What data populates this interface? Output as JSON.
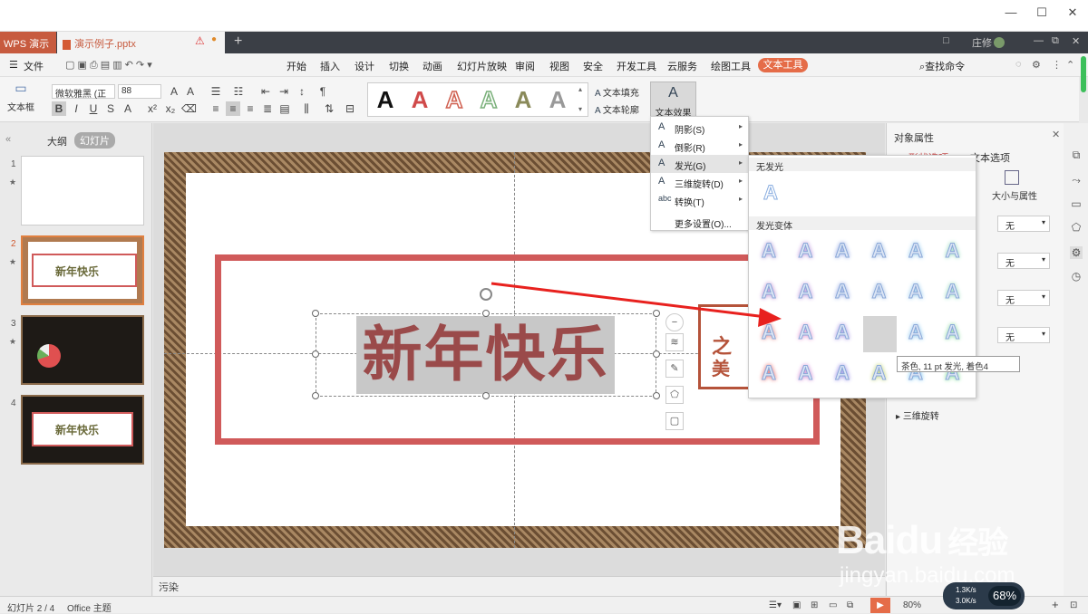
{
  "titlebar": {
    "min": "—",
    "max": "☐",
    "close": "✕"
  },
  "tabs": {
    "app": "WPS 演示",
    "doc": "演示例子.pptx",
    "add": "+",
    "user": "庄修",
    "right_icons": [
      "□",
      "—",
      "⧉",
      "✕"
    ]
  },
  "menubar": {
    "file": "文件",
    "items": [
      "开始",
      "插入",
      "设计",
      "切换",
      "动画",
      "幻灯片放映",
      "审阅",
      "视图",
      "安全",
      "开发工具",
      "云服务",
      "绘图工具"
    ],
    "active": "文本工具",
    "search": "查找命令"
  },
  "ribbon": {
    "textbox": "文本框",
    "font": "微软雅黑 (正文",
    "size": "88",
    "text_fill": "文本填充",
    "text_outline": "文本轮廓",
    "text_effect": "文本效果"
  },
  "left_panel": {
    "outline_tab": "大纲",
    "slides_tab": "幻灯片",
    "nums": [
      "1",
      "2",
      "3",
      "4"
    ],
    "thumb_text": "新年快乐"
  },
  "slide": {
    "title": "新年快乐",
    "stamp1": "之",
    "stamp2": "美"
  },
  "notes": "污染",
  "right_panel": {
    "title": "对象属性",
    "tab1": "形状选项",
    "tab2": "文本选项",
    "size_attr": "大小与属性",
    "none_values": [
      "无",
      "无",
      "无",
      "无"
    ],
    "rotate3d": "三维旋转"
  },
  "effect_menu": {
    "items": [
      {
        "icon": "A",
        "label": "阴影(S)",
        "arrow": "▸"
      },
      {
        "icon": "A",
        "label": "倒影(R)",
        "arrow": "▸"
      },
      {
        "icon": "A",
        "label": "发光(G)",
        "arrow": "▸"
      },
      {
        "icon": "A",
        "label": "三维旋转(D)",
        "arrow": "▸"
      },
      {
        "icon": "abc",
        "label": "转换(T)",
        "arrow": "▸"
      }
    ],
    "more": "更多设置(O)..."
  },
  "glow_menu": {
    "no_glow": "无发光",
    "variants": "发光变体",
    "tooltip": "茶色, 11 pt 发光, 着色4",
    "rows": [
      [
        "#b7a3d9",
        "#c6a5e0",
        "#a7b7e8",
        "#b2c9e8",
        "#a9d3ef",
        "#a9e0c9"
      ],
      [
        "#c49ad6",
        "#c6a5e0",
        "#a7b7e8",
        "#b2c9e8",
        "#a9d3ef",
        "#a9e0c9"
      ],
      [
        "#e79a9a",
        "#e6a6d8",
        "#b3a3e6",
        "#d9cfa8",
        "#9fd0f0",
        "#9fe0b0"
      ],
      [
        "#e98080",
        "#d79ad8",
        "#a59ae8",
        "#c9d98a",
        "#8fcdf2",
        "#8fe0a0"
      ]
    ]
  },
  "statusbar": {
    "slide": "幻灯片 2 / 4",
    "theme": "Office 主题",
    "zoom": "80%",
    "net_up": "1.3K/s",
    "net_down": "3.0K/s",
    "cpu": "68%"
  },
  "watermark": {
    "brand": "Bai",
    "paw": "du",
    "suffix": "经验",
    "url": "jingyan.baidu.com"
  }
}
